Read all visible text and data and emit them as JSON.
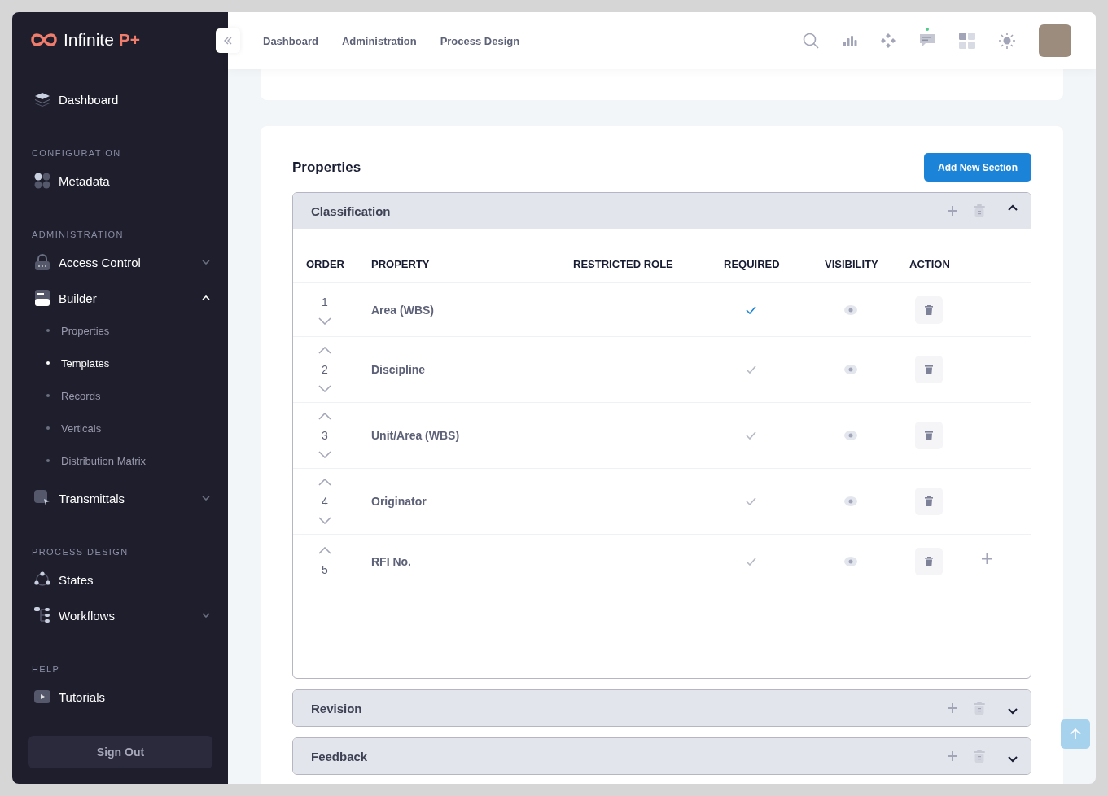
{
  "brand": {
    "name": "Infinite",
    "accent": "P+"
  },
  "sidebar": {
    "groups": [
      {
        "items": [
          {
            "label": "Dashboard"
          }
        ]
      },
      {
        "heading": "CONFIGURATION",
        "items": [
          {
            "label": "Metadata"
          }
        ]
      },
      {
        "heading": "ADMINISTRATION",
        "items": [
          {
            "label": "Access Control",
            "expanded": false
          },
          {
            "label": "Builder",
            "expanded": true,
            "children": [
              {
                "label": "Properties",
                "selected": false
              },
              {
                "label": "Templates",
                "selected": true
              },
              {
                "label": "Records",
                "selected": false
              },
              {
                "label": "Verticals",
                "selected": false
              },
              {
                "label": "Distribution Matrix",
                "selected": false
              }
            ]
          },
          {
            "label": "Transmittals",
            "expanded": false
          }
        ]
      },
      {
        "heading": "PROCESS DESIGN",
        "items": [
          {
            "label": "States"
          },
          {
            "label": "Workflows",
            "expanded": false
          }
        ]
      },
      {
        "heading": "HELP",
        "items": [
          {
            "label": "Tutorials"
          }
        ]
      }
    ],
    "sign_out": "Sign Out"
  },
  "topnav": [
    "Dashboard",
    "Administration",
    "Process Design"
  ],
  "properties": {
    "title": "Properties",
    "add_button": "Add New Section",
    "columns": [
      "ORDER",
      "PROPERTY",
      "RESTRICTED ROLE",
      "REQUIRED",
      "VISIBILITY",
      "ACTION"
    ],
    "sections": [
      {
        "title": "Classification",
        "expanded": true,
        "rows": [
          {
            "order": "1",
            "property": "Area (WBS)",
            "required": true,
            "can_move_up": false,
            "can_move_down": true,
            "show_add": false
          },
          {
            "order": "2",
            "property": "Discipline",
            "required": false,
            "can_move_up": true,
            "can_move_down": true,
            "show_add": false
          },
          {
            "order": "3",
            "property": "Unit/Area (WBS)",
            "required": false,
            "can_move_up": true,
            "can_move_down": true,
            "show_add": false
          },
          {
            "order": "4",
            "property": "Originator",
            "required": false,
            "can_move_up": true,
            "can_move_down": true,
            "show_add": false
          },
          {
            "order": "5",
            "property": "RFI No.",
            "required": false,
            "can_move_up": true,
            "can_move_down": false,
            "show_add": true
          }
        ]
      },
      {
        "title": "Revision",
        "expanded": false
      },
      {
        "title": "Feedback",
        "expanded": false
      }
    ]
  }
}
